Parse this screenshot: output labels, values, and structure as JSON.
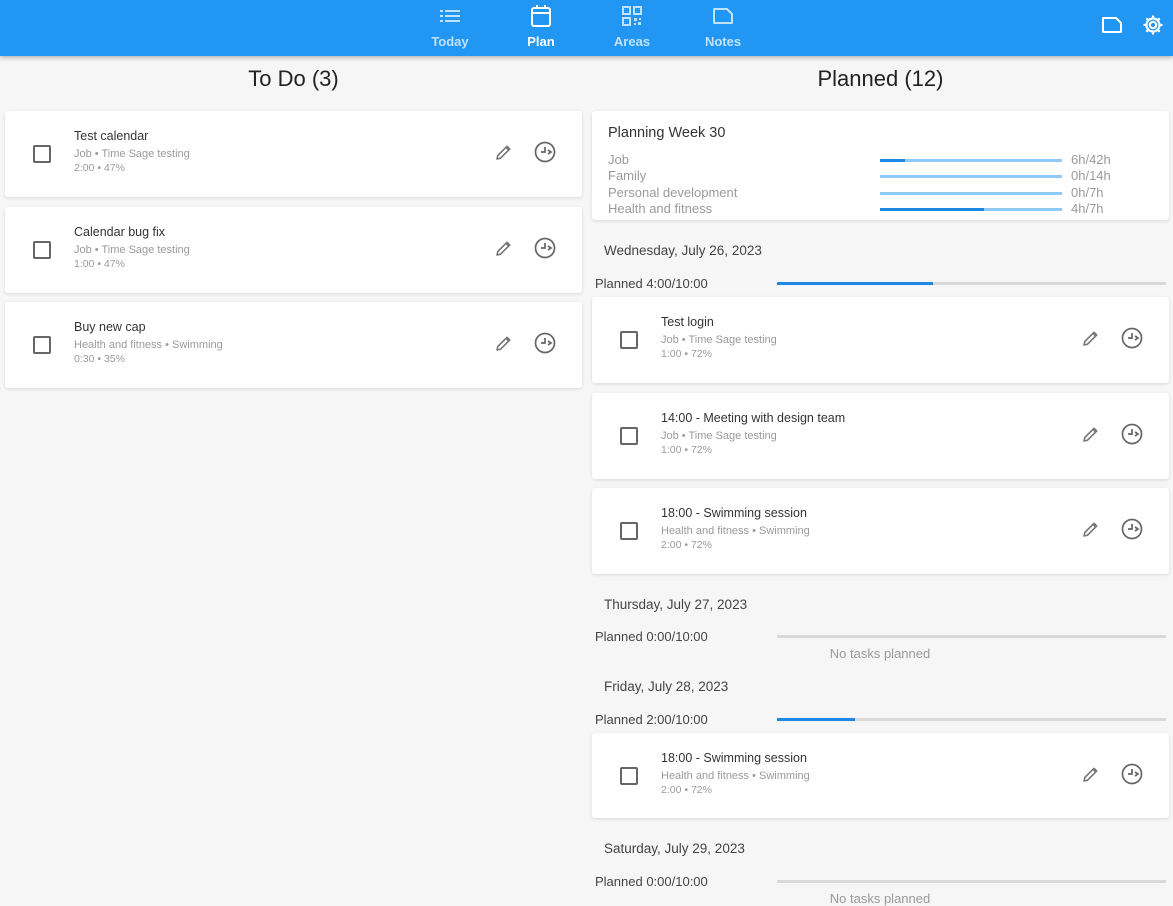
{
  "nav": {
    "items": [
      {
        "label": "Today",
        "icon": "list-icon"
      },
      {
        "label": "Plan",
        "icon": "calendar-icon"
      },
      {
        "label": "Areas",
        "icon": "grid-icon"
      },
      {
        "label": "Notes",
        "icon": "note-icon"
      }
    ],
    "active": "Plan",
    "actions": [
      "note-icon",
      "gear-icon"
    ]
  },
  "colors": {
    "primary": "#2196f3",
    "accent": "#1e88e5",
    "light_accent": "#90caf9"
  },
  "todo": {
    "title": "To Do (3)",
    "tasks": [
      {
        "title": "Test calendar",
        "sub": "Job • Time Sage testing",
        "meta": "2:00 • 47%"
      },
      {
        "title": "Calendar bug fix",
        "sub": "Job • Time Sage testing",
        "meta": "1:00 • 47%"
      },
      {
        "title": "Buy new cap",
        "sub": "Health and fitness • Swimming",
        "meta": "0:30 • 35%"
      }
    ]
  },
  "planned": {
    "title": "Planned (12)",
    "week": {
      "title": "Planning Week 30",
      "rows": [
        {
          "name": "Job",
          "value": "6h/42h",
          "fraction": 0.14
        },
        {
          "name": "Family",
          "value": "0h/14h",
          "fraction": 0
        },
        {
          "name": "Personal development",
          "value": "0h/7h",
          "fraction": 0
        },
        {
          "name": "Health and fitness",
          "value": "4h/7h",
          "fraction": 0.57
        }
      ]
    },
    "days": [
      {
        "date": "Wednesday, July 26, 2023",
        "planned": "Planned 4:00/10:00",
        "fraction": 0.4,
        "tasks": [
          {
            "title": "Test login",
            "sub": "Job • Time Sage testing",
            "meta": "1:00 • 72%"
          },
          {
            "title": "14:00 - Meeting with design team",
            "sub": "Job • Time Sage testing",
            "meta": "1:00 • 72%"
          },
          {
            "title": "18:00 - Swimming session",
            "sub": "Health and fitness • Swimming",
            "meta": "2:00 • 72%"
          }
        ]
      },
      {
        "date": "Thursday, July 27, 2023",
        "planned": "Planned 0:00/10:00",
        "fraction": 0,
        "empty_text": "No tasks planned",
        "tasks": []
      },
      {
        "date": "Friday, July 28, 2023",
        "planned": "Planned 2:00/10:00",
        "fraction": 0.2,
        "tasks": [
          {
            "title": "18:00 - Swimming session",
            "sub": "Health and fitness • Swimming",
            "meta": "2:00 • 72%"
          }
        ]
      },
      {
        "date": "Saturday, July 29, 2023",
        "planned": "Planned 0:00/10:00",
        "fraction": 0,
        "empty_text": "No tasks planned",
        "tasks": []
      }
    ]
  }
}
